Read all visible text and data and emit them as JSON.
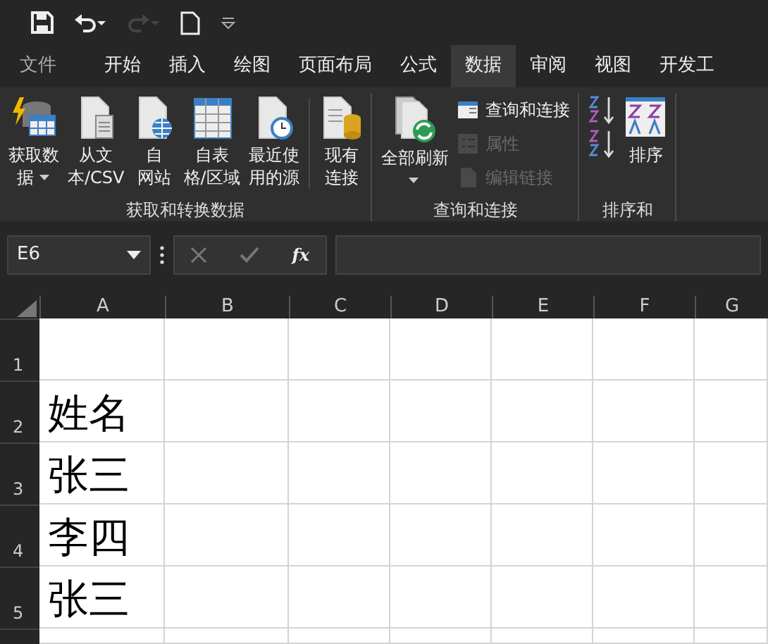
{
  "quick_access": [
    {
      "kind": "save",
      "disabled": false
    },
    {
      "kind": "undo",
      "disabled": false
    },
    {
      "kind": "redo",
      "disabled": true
    },
    {
      "kind": "new",
      "disabled": false
    },
    {
      "kind": "customize",
      "disabled": false
    }
  ],
  "tabs": [
    {
      "label": "文件",
      "selected": false,
      "kind": "file"
    },
    {
      "label": "开始",
      "selected": false,
      "kind": "tab"
    },
    {
      "label": "插入",
      "selected": false,
      "kind": "tab"
    },
    {
      "label": "绘图",
      "selected": false,
      "kind": "tab"
    },
    {
      "label": "页面布局",
      "selected": false,
      "kind": "tab"
    },
    {
      "label": "公式",
      "selected": false,
      "kind": "tab"
    },
    {
      "label": "数据",
      "selected": true,
      "kind": "tab"
    },
    {
      "label": "审阅",
      "selected": false,
      "kind": "tab"
    },
    {
      "label": "视图",
      "selected": false,
      "kind": "tab"
    },
    {
      "label": "开发工",
      "selected": false,
      "kind": "tab"
    }
  ],
  "ribbon_groups": [
    {
      "label": "获取和转换数据",
      "buttons": [
        {
          "kind": "get-data",
          "lines": [
            "获取数",
            "据"
          ],
          "dropdown": true,
          "disabled": false
        },
        {
          "kind": "from-text",
          "lines": [
            "从文",
            "本/CSV"
          ],
          "dropdown": false,
          "disabled": false
        },
        {
          "kind": "from-web",
          "lines": [
            "自",
            "网站"
          ],
          "dropdown": false,
          "disabled": false
        },
        {
          "kind": "from-table",
          "lines": [
            "自表",
            "格/区域"
          ],
          "dropdown": false,
          "disabled": false
        },
        {
          "kind": "recent",
          "lines": [
            "最近使",
            "用的源"
          ],
          "dropdown": false,
          "disabled": false
        },
        {
          "kind": "connections",
          "lines": [
            "现有",
            "连接"
          ],
          "dropdown": false,
          "disabled": false
        }
      ]
    },
    {
      "label": "查询和连接",
      "buttons": [
        {
          "kind": "refresh",
          "lines": [
            "全部刷新"
          ],
          "dropdown": true,
          "disabled": false
        },
        {
          "kind": "queries",
          "lines": [
            "查询和连接"
          ],
          "dropdown": false,
          "disabled": false
        },
        {
          "kind": "properties",
          "lines": [
            "属性"
          ],
          "dropdown": false,
          "disabled": true
        },
        {
          "kind": "edit-links",
          "lines": [
            "编辑链接"
          ],
          "dropdown": false,
          "disabled": true
        }
      ]
    },
    {
      "label": "排序和",
      "buttons": [
        {
          "kind": "sort-asc",
          "dropdown": false,
          "disabled": false
        },
        {
          "kind": "sort-desc",
          "dropdown": false,
          "disabled": false
        },
        {
          "kind": "sort",
          "lines": [
            "排序"
          ],
          "dropdown": false,
          "disabled": false
        }
      ]
    }
  ],
  "formula_bar": {
    "name_box": "E6",
    "function_label": "fx"
  },
  "sheet": {
    "columns": [
      "A",
      "B",
      "C",
      "D",
      "E",
      "F",
      "G"
    ],
    "rows": [
      {
        "number": "1",
        "cells": []
      },
      {
        "number": "2",
        "cells": [
          "姓名"
        ]
      },
      {
        "number": "3",
        "cells": [
          "张三"
        ]
      },
      {
        "number": "4",
        "cells": [
          "李四"
        ]
      },
      {
        "number": "5",
        "cells": [
          "张三"
        ]
      }
    ]
  }
}
